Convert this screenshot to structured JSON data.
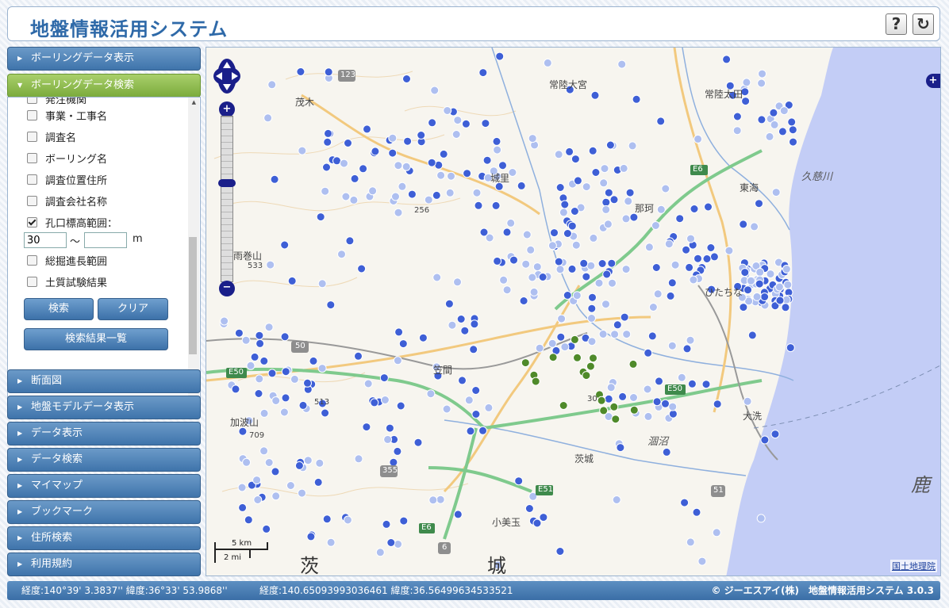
{
  "header": {
    "title": "地盤情報活用システム",
    "help_label": "?",
    "refresh_label": "↻"
  },
  "sidebar": {
    "sections": [
      {
        "label": "ボーリングデータ表示",
        "state": "collapsed"
      },
      {
        "label": "ボーリングデータ検索",
        "state": "expanded"
      },
      {
        "label": "断面図",
        "state": "collapsed"
      },
      {
        "label": "地盤モデルデータ表示",
        "state": "collapsed"
      },
      {
        "label": "データ表示",
        "state": "collapsed"
      },
      {
        "label": "データ検索",
        "state": "collapsed"
      },
      {
        "label": "マイマップ",
        "state": "collapsed"
      },
      {
        "label": "ブックマーク",
        "state": "collapsed"
      },
      {
        "label": "住所検索",
        "state": "collapsed"
      },
      {
        "label": "利用規約",
        "state": "collapsed"
      }
    ],
    "search": {
      "partial_item": "発注機関",
      "criteria": [
        {
          "label": "事業・工事名",
          "checked": false
        },
        {
          "label": "調査名",
          "checked": false
        },
        {
          "label": "ボーリング名",
          "checked": false
        },
        {
          "label": "調査位置住所",
          "checked": false
        },
        {
          "label": "調査会社名称",
          "checked": false
        },
        {
          "label": "孔口標高範囲：",
          "checked": true
        },
        {
          "label": "総掘進長範囲",
          "checked": false
        },
        {
          "label": "土質試験結果",
          "checked": false
        }
      ],
      "elevation_min": "30",
      "elevation_max": "",
      "range_sep": "〜",
      "unit": "m",
      "search_button": "検索",
      "clear_button": "クリア",
      "results_button": "検索結果一覧"
    }
  },
  "map": {
    "labels": {
      "hitachi_omiya": "常陸大宮",
      "hitachi_ota": "常陸太田",
      "motegi": "茂木",
      "shirosato": "城里",
      "naka": "那珂",
      "tokai": "東海",
      "hitachinaka": "ひたちな",
      "kasama": "笠間",
      "oarai": "大洗",
      "ibaraki": "茨城",
      "omitama": "小美玉",
      "amayama": "雨巻山",
      "kabasan": "加波山",
      "kuji_river": "久慈川",
      "hinuma": "涸沼",
      "ibaraki_big": "茨",
      "castle": "城",
      "kashima": "鹿",
      "elev_256": "256",
      "elev_533": "533",
      "elev_513": "513",
      "elev_709": "709",
      "elev_30": "30",
      "route_123": "123",
      "route_50": "50",
      "route_355": "355",
      "route_6": "6",
      "route_51": "51",
      "route_e6a": "E6",
      "route_e6b": "E6",
      "route_e50a": "E50",
      "route_e50b": "E50",
      "route_e51": "E51",
      "scale_km": "5 km",
      "scale_mi": "2 mi"
    },
    "attribution": "国土地理院",
    "colors": {
      "boring_point": "#3e5fd6",
      "boring_point_faded": "#aebff0",
      "boring_point_green": "#4f8a2a",
      "sea": "#c3cdf6"
    }
  },
  "status": {
    "dms_label": "経度:140°39' 3.3837'' 緯度:36°33' 53.9868''",
    "dec_label": "経度:140.65093993036461 緯度:36.56499634533521",
    "copyright": "© ジーエスアイ(株)　地盤情報活用システム 3.0.3"
  }
}
